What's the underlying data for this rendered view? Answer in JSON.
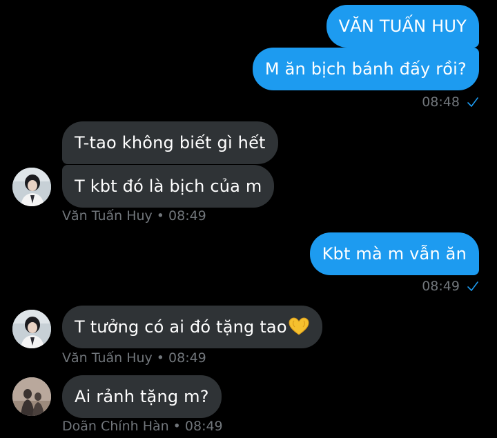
{
  "messages": {
    "m1": {
      "text": "VĂN TUẤN HUY"
    },
    "m2": {
      "text": "M ăn bịch bánh đấy rồi?"
    },
    "m2_time": "08:48",
    "m3": {
      "text": "T-tao không biết gì hết"
    },
    "m4": {
      "text": "T kbt đó là bịch của m"
    },
    "m4_sender": "Văn Tuấn Huy",
    "m4_time": "08:49",
    "m5": {
      "text": "Kbt mà m vẫn ăn"
    },
    "m5_time": "08:49",
    "m6": {
      "text": "T tưởng có ai đó tặng tao",
      "emoji": "heart-hands-emoji"
    },
    "m6_sender": "Văn Tuấn Huy",
    "m6_time": "08:49",
    "m7": {
      "text": "Ai rảnh tặng m?"
    },
    "m7_sender": "Doãn Chính Hàn",
    "m7_time": "08:49",
    "separator": "•"
  },
  "icons": {
    "read_receipt": "check-icon",
    "avatar_huy": "avatar-van-tuan-huy",
    "avatar_han": "avatar-doan-chinh-han"
  },
  "colors": {
    "background": "#000000",
    "outgoing_bubble": "#1d9bf0",
    "incoming_bubble": "#2f3336",
    "meta_text": "#71767b",
    "check": "#1d9bf0"
  }
}
